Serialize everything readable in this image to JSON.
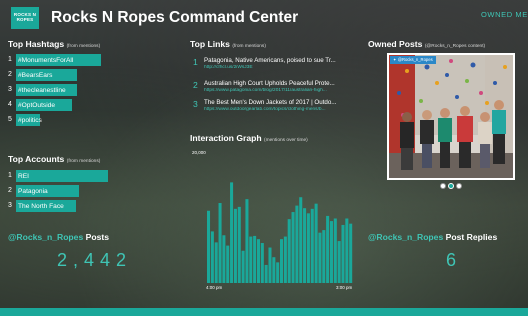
{
  "header": {
    "logo_text": "ROCKS N ROPES",
    "title": "Rocks N Ropes Command Center",
    "owned_metrics": "OWNED METR"
  },
  "hashtags": {
    "title": "Top Hashtags",
    "subtitle": "(from mentions)",
    "items": [
      {
        "rank": "1",
        "label": "#MonumentsForAll",
        "share": 1.0
      },
      {
        "rank": "2",
        "label": "#BearsEars",
        "share": 0.72
      },
      {
        "rank": "3",
        "label": "#thecleanestline",
        "share": 0.72
      },
      {
        "rank": "4",
        "label": "#OptOutside",
        "share": 0.66
      },
      {
        "rank": "5",
        "label": "#politics",
        "share": 0.28
      }
    ]
  },
  "accounts": {
    "title": "Top Accounts",
    "subtitle": "(from mentions)",
    "items": [
      {
        "rank": "1",
        "label": "REI",
        "share": 1.0
      },
      {
        "rank": "2",
        "label": "Patagonia",
        "share": 0.68
      },
      {
        "rank": "3",
        "label": "The North Face",
        "share": 0.65
      }
    ]
  },
  "links": {
    "title": "Top Links",
    "subtitle": "(from mentions)",
    "items": [
      {
        "rank": "1",
        "title": "Patagonia, Native Americans, poised to sue Tr...",
        "url": "http://cfhcl.us/2iWsJ3E"
      },
      {
        "rank": "2",
        "title": "Australian High Court Upholds Peaceful Prote...",
        "url": "https://www.patagonia.com/blog/2017/11/australian-high..."
      },
      {
        "rank": "3",
        "title": "The Best Men's Down Jackets of 2017 | Outdo...",
        "url": "https://www.outdoorgearlab.com/topics/clothing-mens/b..."
      }
    ]
  },
  "graph": {
    "title": "Interaction Graph",
    "subtitle": "(mentions over time)",
    "y_top_label": "20,000",
    "x_start_label": "4:00 pm",
    "x_end_label": "3:00 pm"
  },
  "chart_data": {
    "type": "bar",
    "title": "Interaction Graph",
    "ylim": [
      0,
      20000
    ],
    "values": [
      11200,
      8000,
      6300,
      12400,
      7400,
      5800,
      15600,
      11500,
      11800,
      5000,
      13000,
      7200,
      7300,
      6800,
      6200,
      2800,
      5500,
      4000,
      3200,
      6800,
      7200,
      9900,
      11000,
      12000,
      13300,
      11600,
      10800,
      11500,
      12300,
      7800,
      8200,
      10400,
      9600,
      10000,
      6500,
      9000,
      10000,
      9200
    ]
  },
  "owned_posts": {
    "title": "Owned Posts",
    "subtitle": "(@Rocks_n_Ropes content)",
    "photo_tag": "@Rocks_n_Ropes"
  },
  "stats": {
    "posts_handle": "@Rocks_n_Ropes",
    "posts_suffix": "Posts",
    "posts_value": "2,442",
    "replies_handle": "@Rocks_n_Ropes",
    "replies_suffix": "Post Replies",
    "replies_value": "6"
  },
  "colors": {
    "accent": "#1aa89a",
    "accent_text": "#3fc5b5"
  },
  "icons": {
    "photo_source": "twitter-icon",
    "wall_holds": "climbing-hold"
  }
}
